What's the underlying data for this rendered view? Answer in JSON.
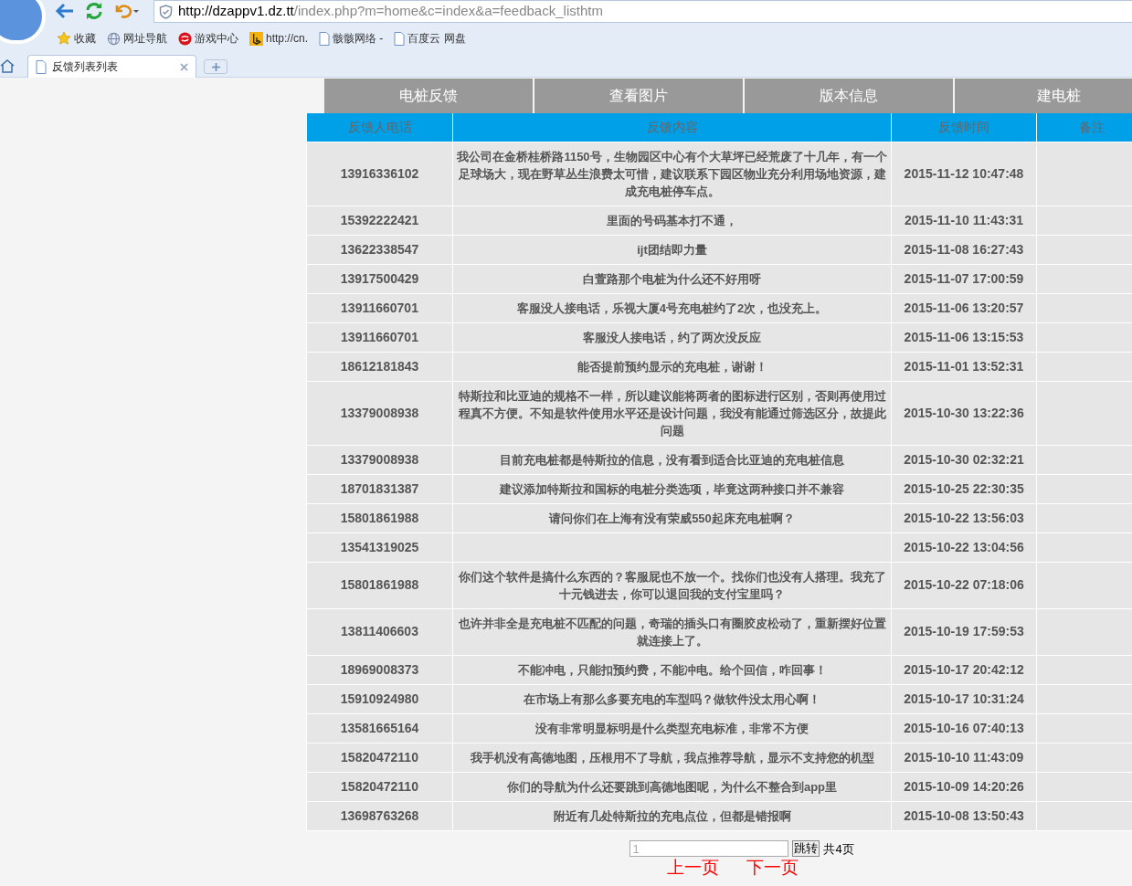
{
  "browser": {
    "address": {
      "host": "http://dzappv1.dz.tt",
      "path": "/index.php?m=home&c=index&a=feedback_listhtm"
    },
    "bookmarks": [
      {
        "kind": "star",
        "label": "收藏"
      },
      {
        "kind": "globe",
        "label": "网址导航"
      },
      {
        "kind": "game",
        "label": "游戏中心"
      },
      {
        "kind": "bing",
        "label": "http://cn."
      },
      {
        "kind": "page",
        "label": "骸骸网络 -"
      },
      {
        "kind": "page",
        "label": "百度云 网盘"
      }
    ],
    "tabs": [
      {
        "title": "反馈列表列表",
        "selected": true
      }
    ]
  },
  "nav": [
    "电桩反馈",
    "查看图片",
    "版本信息",
    "建电桩"
  ],
  "table": {
    "columns": [
      "反馈人电话",
      "反馈内容",
      "反馈时间",
      "备注"
    ],
    "rows": [
      [
        "13916336102",
        "我公司在金桥桂桥路1150号，生物园区中心有个大草坪已经荒废了十几年，有一个足球场大，现在野草丛生浪费太可惜，建议联系下园区物业充分利用场地资源，建成充电桩停车点。",
        "2015-11-12 10:47:48"
      ],
      [
        "15392222421",
        "里面的号码基本打不通，",
        "2015-11-10 11:43:31"
      ],
      [
        "13622338547",
        "ijt团结即力量",
        "2015-11-08 16:27:43"
      ],
      [
        "13917500429",
        "白萱路那个电桩为什么还不好用呀",
        "2015-11-07 17:00:59"
      ],
      [
        "13911660701",
        "客服没人接电话，乐视大厦4号充电桩约了2次，也没充上。",
        "2015-11-06 13:20:57"
      ],
      [
        "13911660701",
        "客服没人接电话，约了两次没反应",
        "2015-11-06 13:15:53"
      ],
      [
        "18612181843",
        "能否提前预约显示的充电桩，谢谢！",
        "2015-11-01 13:52:31"
      ],
      [
        "13379008938",
        "特斯拉和比亚迪的规格不一样，所以建议能将两者的图标进行区别，否则再使用过程真不方便。不知是软件使用水平还是设计问题，我没有能通过筛选区分，故提此问题",
        "2015-10-30 13:22:36"
      ],
      [
        "13379008938",
        "目前充电桩都是特斯拉的信息，没有看到适合比亚迪的充电桩信息",
        "2015-10-30 02:32:21"
      ],
      [
        "18701831387",
        "建议添加特斯拉和国标的电桩分类选项，毕竟这两种接口并不兼容",
        "2015-10-25 22:30:35"
      ],
      [
        "15801861988",
        "请问你们在上海有没有荣威550起床充电桩啊？",
        "2015-10-22 13:56:03"
      ],
      [
        "13541319025",
        null,
        "2015-10-22 13:04:56"
      ],
      [
        "15801861988",
        "你们这个软件是搞什么东西的？客服屁也不放一个。找你们也没有人搭理。我充了十元钱进去，你可以退回我的支付宝里吗？",
        "2015-10-22 07:18:06"
      ],
      [
        "13811406603",
        "也许并非全是充电桩不匹配的问题，奇瑞的插头口有圈胶皮松动了，重新摆好位置就连接上了。",
        "2015-10-19 17:59:53"
      ],
      [
        "18969008373",
        "不能冲电，只能扣预约费，不能冲电。给个回信，咋回事！",
        "2015-10-17 20:42:12"
      ],
      [
        "15910924980",
        "在市场上有那么多要充电的车型吗？做软件没太用心啊！",
        "2015-10-17 10:31:24"
      ],
      [
        "13581665164",
        "没有非常明显标明是什么类型充电标准，非常不方便",
        "2015-10-16 07:40:13"
      ],
      [
        "15820472110",
        "我手机没有高德地图，压根用不了导航，我点推荐导航，显示不支持您的机型",
        "2015-10-10 11:43:09"
      ],
      [
        "15820472110",
        "你们的导航为什么还要跳到高德地图呢，为什么不整合到app里",
        "2015-10-09 14:20:26"
      ],
      [
        "13698763268",
        "附近有几处特斯拉的充电点位，但都是错报啊",
        "2015-10-08 13:50:43"
      ]
    ]
  },
  "pagination": {
    "page_input": "1",
    "jump_button": "跳转",
    "total": "共4页",
    "prev": "上一页",
    "next": "下一页"
  }
}
